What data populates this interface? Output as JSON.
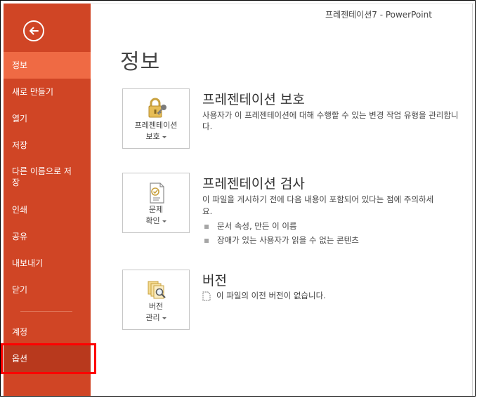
{
  "window": {
    "title": "프레젠테이션7 - PowerPoint"
  },
  "sidebar": {
    "items": [
      {
        "label": "정보"
      },
      {
        "label": "새로 만들기"
      },
      {
        "label": "열기"
      },
      {
        "label": "저장"
      },
      {
        "label": "다른 이름으로 저장"
      },
      {
        "label": "인쇄"
      },
      {
        "label": "공유"
      },
      {
        "label": "내보내기"
      },
      {
        "label": "닫기"
      },
      {
        "label": "계정"
      },
      {
        "label": "옵션"
      }
    ]
  },
  "main": {
    "title": "정보",
    "protect": {
      "button_label_1": "프레젠테이션",
      "button_label_2": "보호",
      "title": "프레젠테이션 보호",
      "desc_1": "사용자가 이 프레젠테이션에 대해 수행할 수 있는 변경 작업 유형을 관리합니",
      "desc_2": "다."
    },
    "inspect": {
      "button_label_1": "문제",
      "button_label_2": "확인",
      "title": "프레젠테이션 검사",
      "desc_1": "이 파일을 게시하기 전에 다음 내용이 포함되어 있다는 점에 주의하세",
      "desc_2": "요.",
      "bullets": [
        "문서 속성, 만든 이 이름",
        "장애가 있는 사용자가 읽을 수 없는 콘텐츠"
      ]
    },
    "versions": {
      "button_label_1": "버전",
      "button_label_2": "관리",
      "title": "버전",
      "desc": "이 파일의 이전 버전이 없습니다."
    }
  },
  "colors": {
    "sidebar": "#d04525",
    "active": "#ef6a44",
    "selected": "#b8391d",
    "highlight": "#ff0000"
  }
}
